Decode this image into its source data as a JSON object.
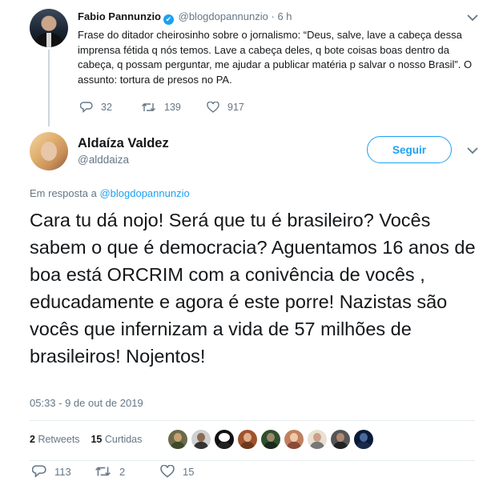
{
  "parent_tweet": {
    "name": "Fabio Pannunzio",
    "handle": "@blogdopannunzio",
    "separator": "·",
    "time": "6 h",
    "text": "Frase do ditador cheirosinho sobre o jornalismo: “Deus, salve, lave a cabeça dessa imprensa fétida q nós temos. Lave a cabeça deles, q bote coisas boas dentro da cabeça, q possam perguntar, me ajudar a publicar matéria p salvar o nosso Brasil”. O assunto: tortura de presos no PA.",
    "replies": "32",
    "retweets": "139",
    "likes": "917"
  },
  "reply_tweet": {
    "name": "Aldaíza Valdez",
    "handle": "@alddaiza",
    "follow_label": "Seguir",
    "in_reply_prefix": "Em resposta a",
    "in_reply_mention": "@blogdopannunzio",
    "text": "Cara tu dá nojo! Será que tu é brasileiro? Vocês sabem o que é democracia? Aguentamos 16 anos de boa está ORCRIM com a conivência de vocês , educadamente e agora é este porre! Nazistas são vocês que infernizam a vida de 57 milhões de brasileiros! Nojentos!",
    "timestamp": "05:33 - 9 de out de 2019",
    "retweet_count": "2",
    "retweet_label": "Retweets",
    "like_count": "15",
    "like_label": "Curtidas",
    "replies": "113",
    "retweets": "2",
    "likes": "15"
  },
  "colors": {
    "accent": "#1da1f2",
    "secondary_text": "#657786",
    "primary_text": "#14171a",
    "divider": "#e6ecf0"
  },
  "icons": [
    "verified-icon",
    "chevron-down-icon",
    "reply-icon",
    "retweet-icon",
    "like-icon"
  ]
}
